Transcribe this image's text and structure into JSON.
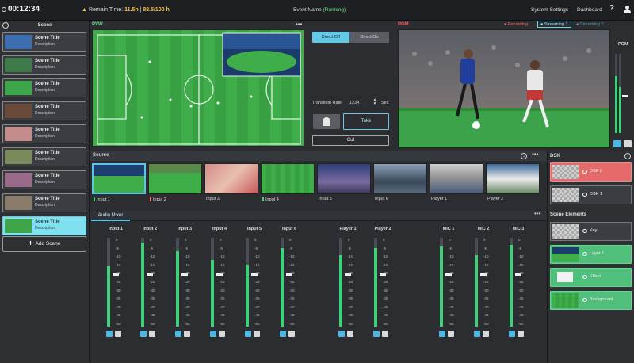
{
  "topbar": {
    "timer": "00:12:34",
    "remain_label": "Remain Time:",
    "remain_value": "11.5h",
    "remain_sep": " | ",
    "remain_usage": "88.5/100 h",
    "event_label": "Event Name",
    "event_status": "(Running)",
    "system_settings": "System Settings",
    "dashboard": "Dashboard",
    "help": "?"
  },
  "scene": {
    "header": "Scene",
    "items": [
      {
        "title": "Scene Title",
        "desc": "Description",
        "thumb": "#3d6fb0"
      },
      {
        "title": "Scene Title",
        "desc": "Description",
        "thumb": "#3f7a4a"
      },
      {
        "title": "Scene Title",
        "desc": "Description",
        "thumb": "#3ea64a"
      },
      {
        "title": "Scene Title",
        "desc": "Description",
        "thumb": "#6a4a3a"
      },
      {
        "title": "Scene Title",
        "desc": "Description",
        "thumb": "#c48c8c"
      },
      {
        "title": "Scene Title",
        "desc": "Description",
        "thumb": "#7a8a5a"
      },
      {
        "title": "Scene Title",
        "desc": "Description",
        "thumb": "#9a6a8a"
      },
      {
        "title": "Scene Title",
        "desc": "Description",
        "thumb": "#8a7a6a"
      },
      {
        "title": "Scene Title",
        "desc": "Description",
        "thumb": "#3fa54a"
      }
    ],
    "add": "Add Scene"
  },
  "pvw": {
    "label": "PVW"
  },
  "controls": {
    "direct_off": "Direct Off",
    "direct_on": "Direct On",
    "transition_label": "Transition Rate",
    "transition_value": "1234",
    "transition_unit": "Sec",
    "take": "Take",
    "cut": "Cut"
  },
  "pgm": {
    "label": "PGM",
    "recording": "● Recording",
    "streaming1": "● Streaming 1",
    "streaming2": "● Streaming 2",
    "meter_label": "PGM",
    "meter_levels": [
      0.72,
      0.58
    ]
  },
  "source": {
    "label": "Source",
    "items": [
      {
        "label": "Input 1",
        "bar": "#3fd07a"
      },
      {
        "label": "Input 2",
        "bar": "#ff7a7a"
      },
      {
        "label": "Input 3",
        "bar": ""
      },
      {
        "label": "Input 4",
        "bar": "#3fd07a"
      },
      {
        "label": "Input 5",
        "bar": ""
      },
      {
        "label": "Input 6",
        "bar": ""
      },
      {
        "label": "Player 1",
        "bar": ""
      },
      {
        "label": "Player 2",
        "bar": ""
      }
    ]
  },
  "audio": {
    "tab": "Audio Mixer",
    "scale": [
      "0",
      "-5",
      "-10",
      "-15",
      "-20",
      "-25",
      "-30",
      "-35",
      "-40",
      "-45",
      "-50"
    ],
    "channels": [
      {
        "name": "Input 1",
        "level": 0.68,
        "fader": 0.6
      },
      {
        "name": "Input 2",
        "level": 0.95,
        "fader": 0.6
      },
      {
        "name": "Input 3",
        "level": 0.85,
        "fader": 0.6
      },
      {
        "name": "Input 4",
        "level": 0.75,
        "fader": 0.6
      },
      {
        "name": "Input 5",
        "level": 0.7,
        "fader": 0.6
      },
      {
        "name": "Input 6",
        "level": 0.88,
        "fader": 0.6
      },
      {
        "name": "Player 1",
        "level": 0.8,
        "fader": 0.6
      },
      {
        "name": "Player 2",
        "level": 0.88,
        "fader": 0.6
      },
      {
        "name": "MIC 1",
        "level": 0.9,
        "fader": 0.6
      },
      {
        "name": "MIC 2",
        "level": 0.8,
        "fader": 0.6
      },
      {
        "name": "MIC 3",
        "level": 0.92,
        "fader": 0.6
      }
    ]
  },
  "dsk": {
    "label": "DSK",
    "items": [
      {
        "label": "DSK 2"
      },
      {
        "label": "DSK 1"
      }
    ]
  },
  "scene_elements": {
    "label": "Scene Elements",
    "items": [
      {
        "label": "Key"
      },
      {
        "label": "Layer 1"
      },
      {
        "label": "Effect"
      },
      {
        "label": "Background"
      }
    ]
  }
}
